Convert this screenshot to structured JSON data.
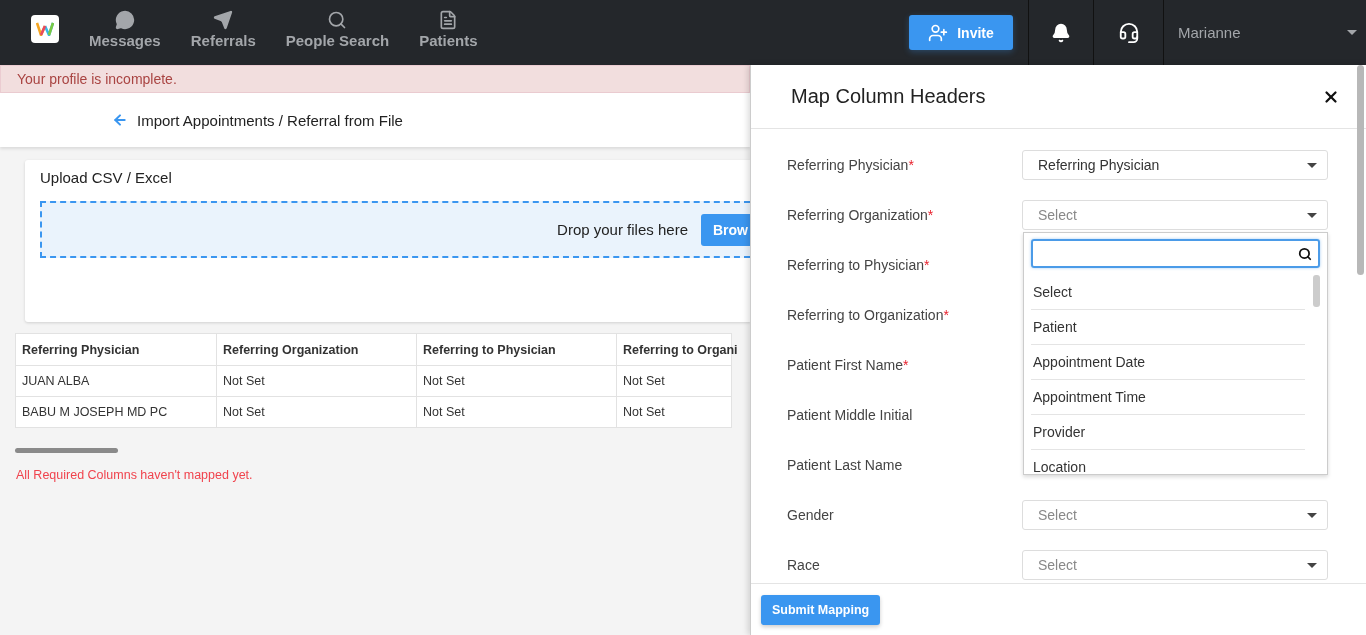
{
  "nav": {
    "items": [
      {
        "label": "Messages",
        "kind": "chat"
      },
      {
        "label": "Referrals",
        "kind": "plane"
      },
      {
        "label": "People Search",
        "kind": "search"
      },
      {
        "label": "Patients",
        "kind": "document"
      }
    ],
    "invite": "Invite",
    "user": "Marianne"
  },
  "alert": "Your profile is incomplete.",
  "page_title": "Import Appointments / Referral from File",
  "upload": {
    "title": "Upload CSV / Excel",
    "drop_text": "Drop your files here",
    "browse": "Brow"
  },
  "table": {
    "columns": [
      "Referring Physician",
      "Referring Organization",
      "Referring to Physician",
      "Referring to Organi"
    ],
    "rows": [
      [
        "JUAN ALBA",
        "Not Set",
        "Not Set",
        "Not Set"
      ],
      [
        "BABU M JOSEPH MD PC",
        "Not Set",
        "Not Set",
        "Not Set"
      ]
    ]
  },
  "error": "All Required Columns haven't mapped yet.",
  "drawer": {
    "title": "Map Column Headers",
    "fields": [
      {
        "label": "Referring Physician",
        "mark": "*",
        "select": {
          "value": "Referring Physician"
        }
      },
      {
        "label": "Referring Organization",
        "mark": "*",
        "select": {
          "placeholder": "Select",
          "open": true,
          "options": [
            "Select",
            "Patient",
            "Appointment Date",
            "Appointment Time",
            "Provider",
            "Location"
          ]
        }
      },
      {
        "label": "Referring to Physician",
        "mark": "*"
      },
      {
        "label": "Referring to Organization",
        "mark": "*"
      },
      {
        "label": "Patient First Name",
        "mark": "*"
      },
      {
        "label": "Patient Middle Initial"
      },
      {
        "label": "Patient Last Name"
      },
      {
        "label": "Gender",
        "select": {
          "placeholder": "Select"
        }
      },
      {
        "label": "Race",
        "select": {
          "placeholder": "Select"
        }
      }
    ],
    "submit": "Submit Mapping"
  }
}
